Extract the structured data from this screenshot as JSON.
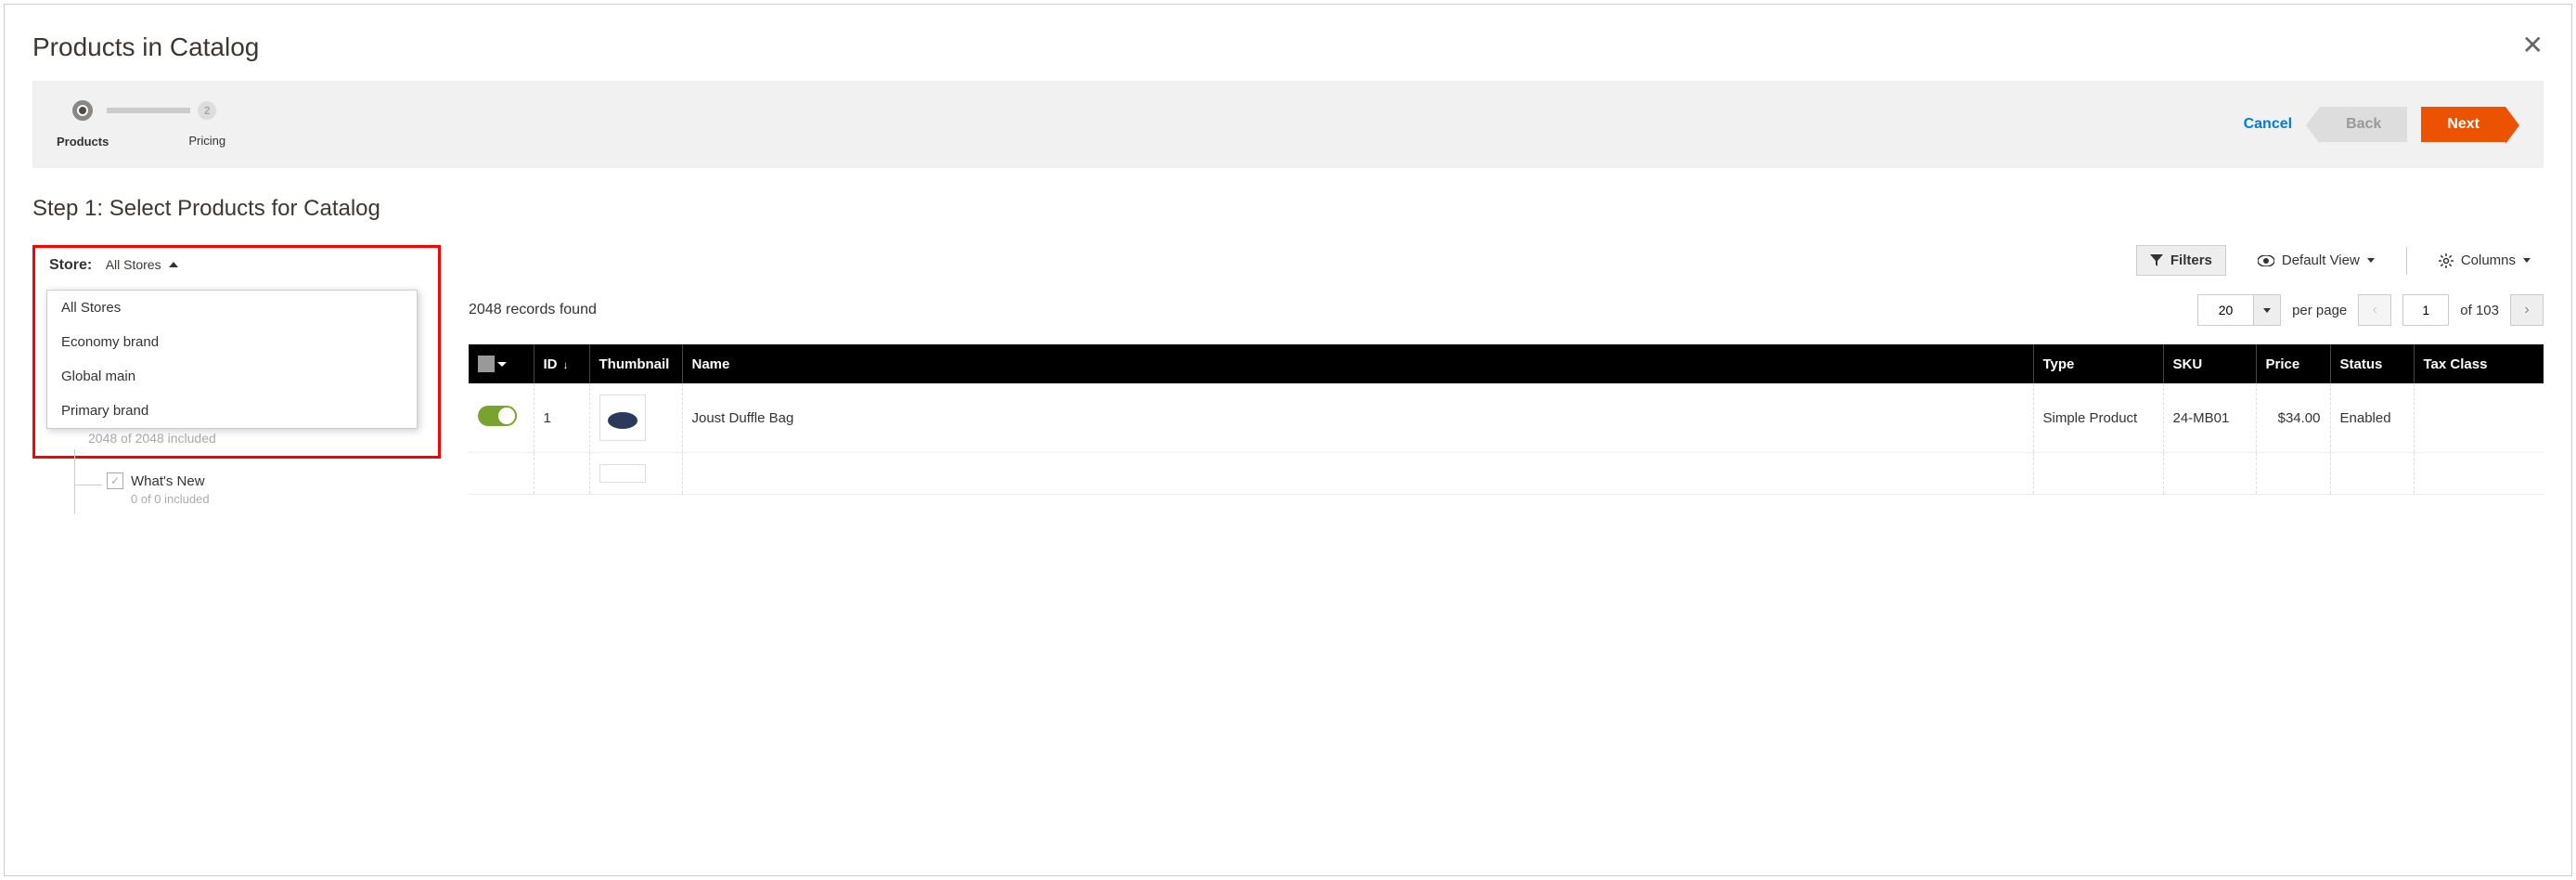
{
  "modal": {
    "title": "Products in Catalog"
  },
  "wizard": {
    "steps": [
      {
        "label": "Products",
        "num": ""
      },
      {
        "label": "Pricing",
        "num": "2"
      }
    ],
    "cancel": "Cancel",
    "back": "Back",
    "next": "Next"
  },
  "step_title": "Step 1: Select Products for Catalog",
  "store": {
    "label": "Store:",
    "selected": "All Stores",
    "options": [
      "All Stores",
      "Economy brand",
      "Global main",
      "Primary brand"
    ]
  },
  "tree": {
    "count_visible": "2048 of 2048 included",
    "whats_new": {
      "label": "What's New",
      "count": "0 of 0 included"
    }
  },
  "toolbar": {
    "filters": "Filters",
    "default_view": "Default View",
    "columns": "Columns"
  },
  "records": "2048 records found",
  "pagination": {
    "page_size": "20",
    "per_page": "per page",
    "current": "1",
    "of_label": "of 103"
  },
  "table": {
    "columns": [
      "",
      "ID",
      "Thumbnail",
      "Name",
      "Type",
      "SKU",
      "Price",
      "Status",
      "Tax Class"
    ],
    "rows": [
      {
        "id": "1",
        "name": "Joust Duffle Bag",
        "type": "Simple Product",
        "sku": "24-MB01",
        "price": "$34.00",
        "status": "Enabled",
        "tax": ""
      }
    ]
  }
}
